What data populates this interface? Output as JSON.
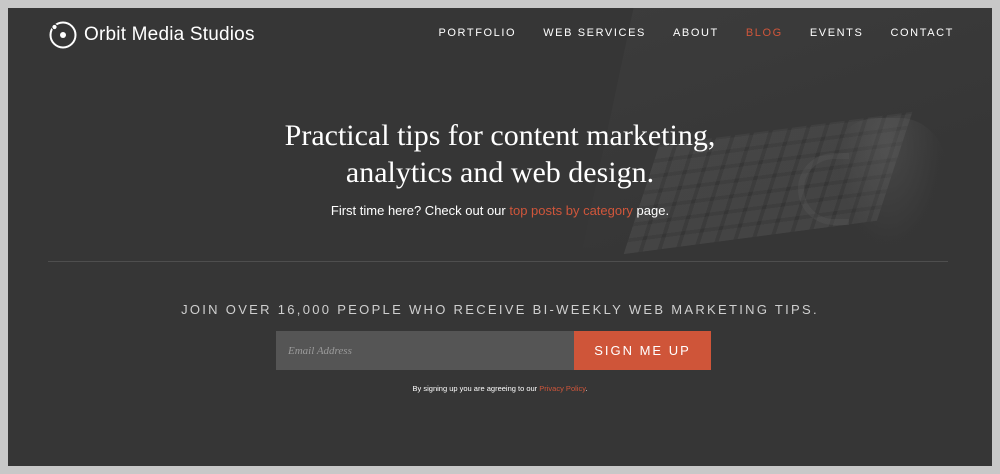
{
  "brand": {
    "name": "Orbit Media Studios",
    "logo_icon": "orbit-logo-icon"
  },
  "nav": {
    "items": [
      {
        "label": "PORTFOLIO",
        "active": false
      },
      {
        "label": "WEB SERVICES",
        "active": false
      },
      {
        "label": "ABOUT",
        "active": false
      },
      {
        "label": "BLOG",
        "active": true
      },
      {
        "label": "EVENTS",
        "active": false
      },
      {
        "label": "CONTACT",
        "active": false
      }
    ]
  },
  "hero": {
    "title_line1": "Practical tips for content marketing,",
    "title_line2": "analytics and web design.",
    "sub_prefix": "First time here? Check out our ",
    "sub_link": "top posts by category",
    "sub_suffix": " page."
  },
  "signup": {
    "heading": "JOIN OVER 16,000 PEOPLE WHO RECEIVE BI-WEEKLY WEB MARKETING TIPS.",
    "email_placeholder": "Email Address",
    "email_value": "",
    "button_label": "SIGN ME UP",
    "policy_prefix": "By signing up you are agreeing to our ",
    "policy_link": "Privacy Policy",
    "policy_suffix": "."
  },
  "colors": {
    "background": "#363636",
    "accent": "#d0563b",
    "input_bg": "#555555",
    "frame": "#c8c8c8"
  }
}
